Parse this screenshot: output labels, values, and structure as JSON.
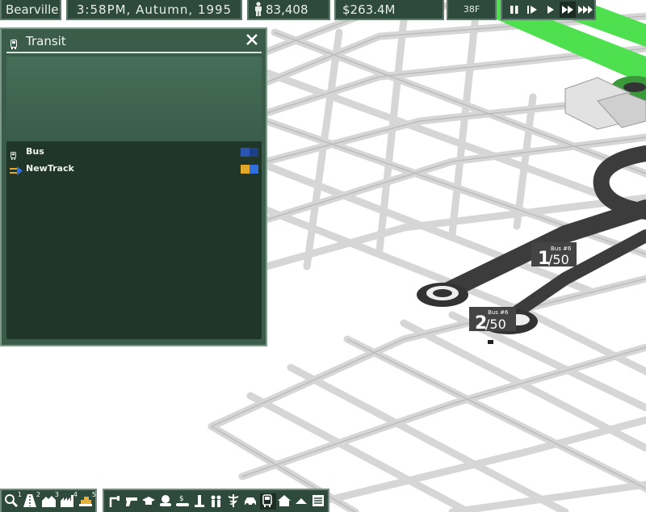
{
  "hud": {
    "city": "Bearville",
    "clock": "3:58PM, Autumn, 1995",
    "population": "83,408",
    "money": "$263.4M",
    "temperature": "38F",
    "speed_controls": [
      "pause-icon",
      "play-slow-icon",
      "play-icon",
      "fast-forward-icon",
      "fastest-icon"
    ],
    "active_speed": "fast-forward-icon"
  },
  "panel": {
    "title": "Transit",
    "icon": "bus-icon",
    "close_icon": "close-icon",
    "lines": [
      {
        "label": "Bus",
        "icon": "bus-icon",
        "colors": [
          "#2a55b0",
          "#1d3f86"
        ]
      },
      {
        "label": "NewTrack",
        "icon": "track-arrow-icon",
        "colors": [
          "#e0a82a",
          "#2f6fe0"
        ]
      }
    ]
  },
  "map": {
    "line_labels": [
      {
        "count": "1",
        "capacity": "/50",
        "bus": "Bus #6"
      },
      {
        "count": "2",
        "capacity": "/50",
        "bus": "Bus #6"
      }
    ]
  },
  "toolbar_left": [
    {
      "icon": "magnifier-icon",
      "number": "1"
    },
    {
      "icon": "road-icon",
      "number": "2"
    },
    {
      "icon": "houses-icon",
      "number": "3"
    },
    {
      "icon": "factory-icon",
      "number": "4"
    },
    {
      "icon": "bulldozer-icon",
      "number": "5"
    }
  ],
  "toolbar_right": [
    {
      "icon": "pipe-icon"
    },
    {
      "icon": "gun-icon"
    },
    {
      "icon": "graduation-cap-icon"
    },
    {
      "icon": "hand-holding-icon"
    },
    {
      "icon": "money-hand-icon"
    },
    {
      "icon": "landmark-icon"
    },
    {
      "icon": "family-icon"
    },
    {
      "icon": "caduceus-icon"
    },
    {
      "icon": "car-icon"
    },
    {
      "icon": "bus-icon",
      "active": true
    },
    {
      "icon": "house-icon"
    },
    {
      "icon": "park-icon"
    },
    {
      "icon": "list-icon"
    }
  ]
}
